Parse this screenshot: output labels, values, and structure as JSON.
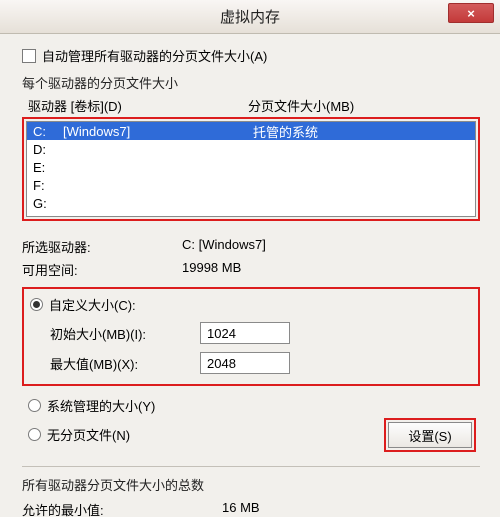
{
  "window": {
    "title": "虚拟内存",
    "close_glyph": "×"
  },
  "auto_manage": {
    "label": "自动管理所有驱动器的分页文件大小(A)",
    "checked": false
  },
  "drive_section": {
    "label": "每个驱动器的分页文件大小",
    "header_drive": "驱动器 [卷标](D)",
    "header_paging": "分页文件大小(MB)",
    "rows": [
      {
        "drive": "C:",
        "volume": "[Windows7]",
        "paging": "托管的系统",
        "selected": true
      },
      {
        "drive": "D:",
        "volume": "",
        "paging": "",
        "selected": false
      },
      {
        "drive": "E:",
        "volume": "",
        "paging": "",
        "selected": false
      },
      {
        "drive": "F:",
        "volume": "",
        "paging": "",
        "selected": false
      },
      {
        "drive": "G:",
        "volume": "",
        "paging": "",
        "selected": false
      }
    ]
  },
  "selected_drive": {
    "label": "所选驱动器:",
    "value": "C:  [Windows7]",
    "space_label": "可用空间:",
    "space_value": "19998 MB"
  },
  "size_options": {
    "custom_label": "自定义大小(C):",
    "initial_label": "初始大小(MB)(I):",
    "initial_value": "1024",
    "max_label": "最大值(MB)(X):",
    "max_value": "2048",
    "system_label": "系统管理的大小(Y)",
    "none_label": "无分页文件(N)",
    "set_button": "设置(S)"
  },
  "totals": {
    "label": "所有驱动器分页文件大小的总数",
    "min_label": "允许的最小值:",
    "min_value": "16 MB"
  }
}
